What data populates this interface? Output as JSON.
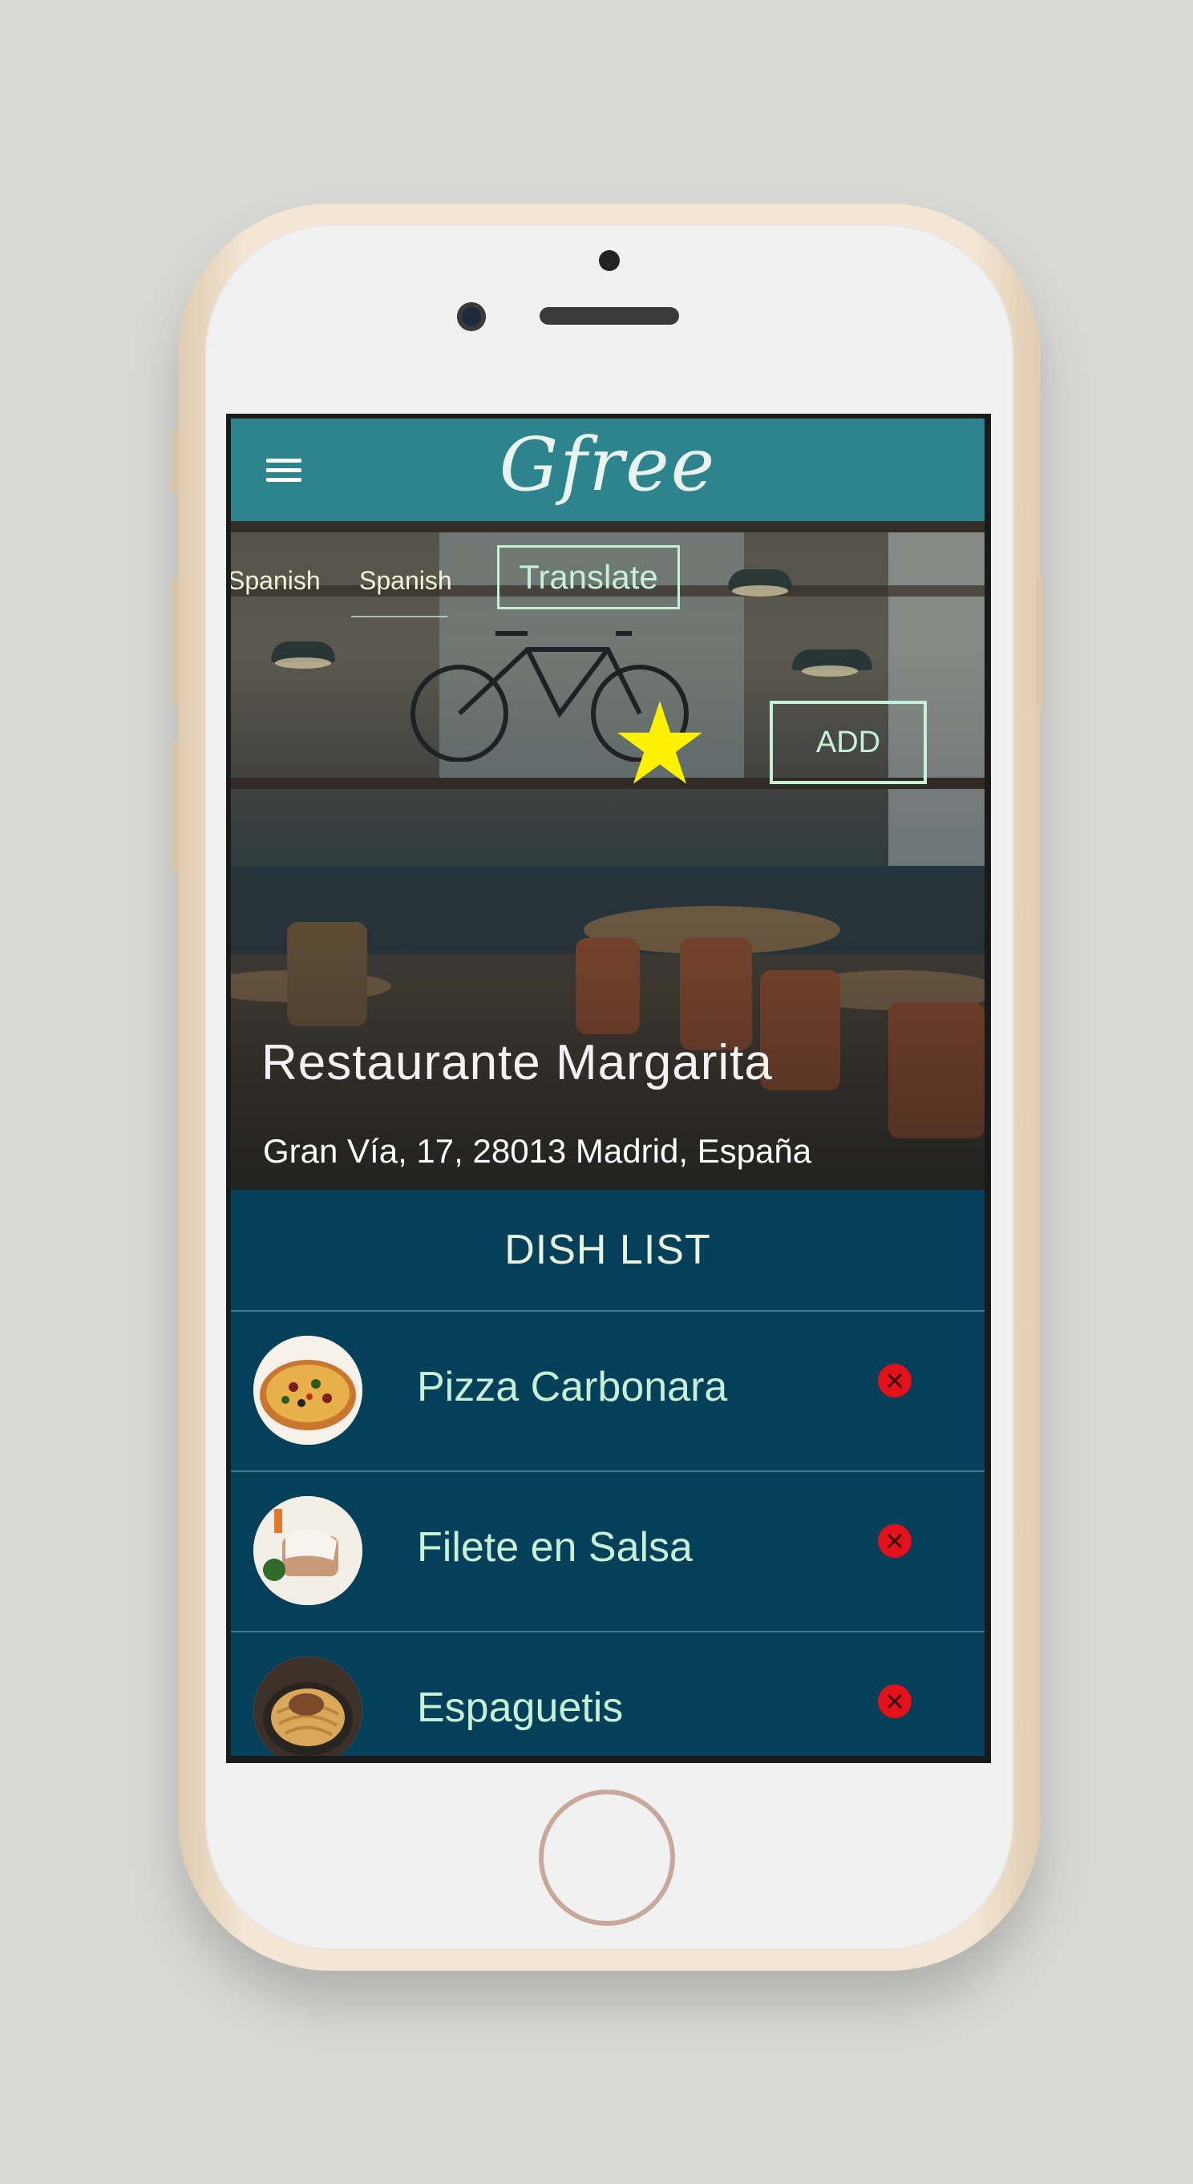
{
  "app": {
    "brand": "Gfree"
  },
  "hero": {
    "lang_left": "Spanish",
    "lang_right": "Spanish",
    "translate_label": "Translate",
    "add_label": "ADD",
    "restaurant_name": "Restaurante Margarita",
    "address": "Gran Vía, 17, 28013 Madrid, España"
  },
  "dishes": {
    "header": "DISH LIST",
    "items": [
      {
        "name": "Pizza Carbonara"
      },
      {
        "name": "Filete en Salsa"
      },
      {
        "name": "Espaguetis"
      }
    ]
  },
  "colors": {
    "topbar": "#2d848d",
    "list_bg": "#04405a",
    "accent": "#c5f2d6",
    "star": "#fff200",
    "remove": "#e3121b"
  }
}
